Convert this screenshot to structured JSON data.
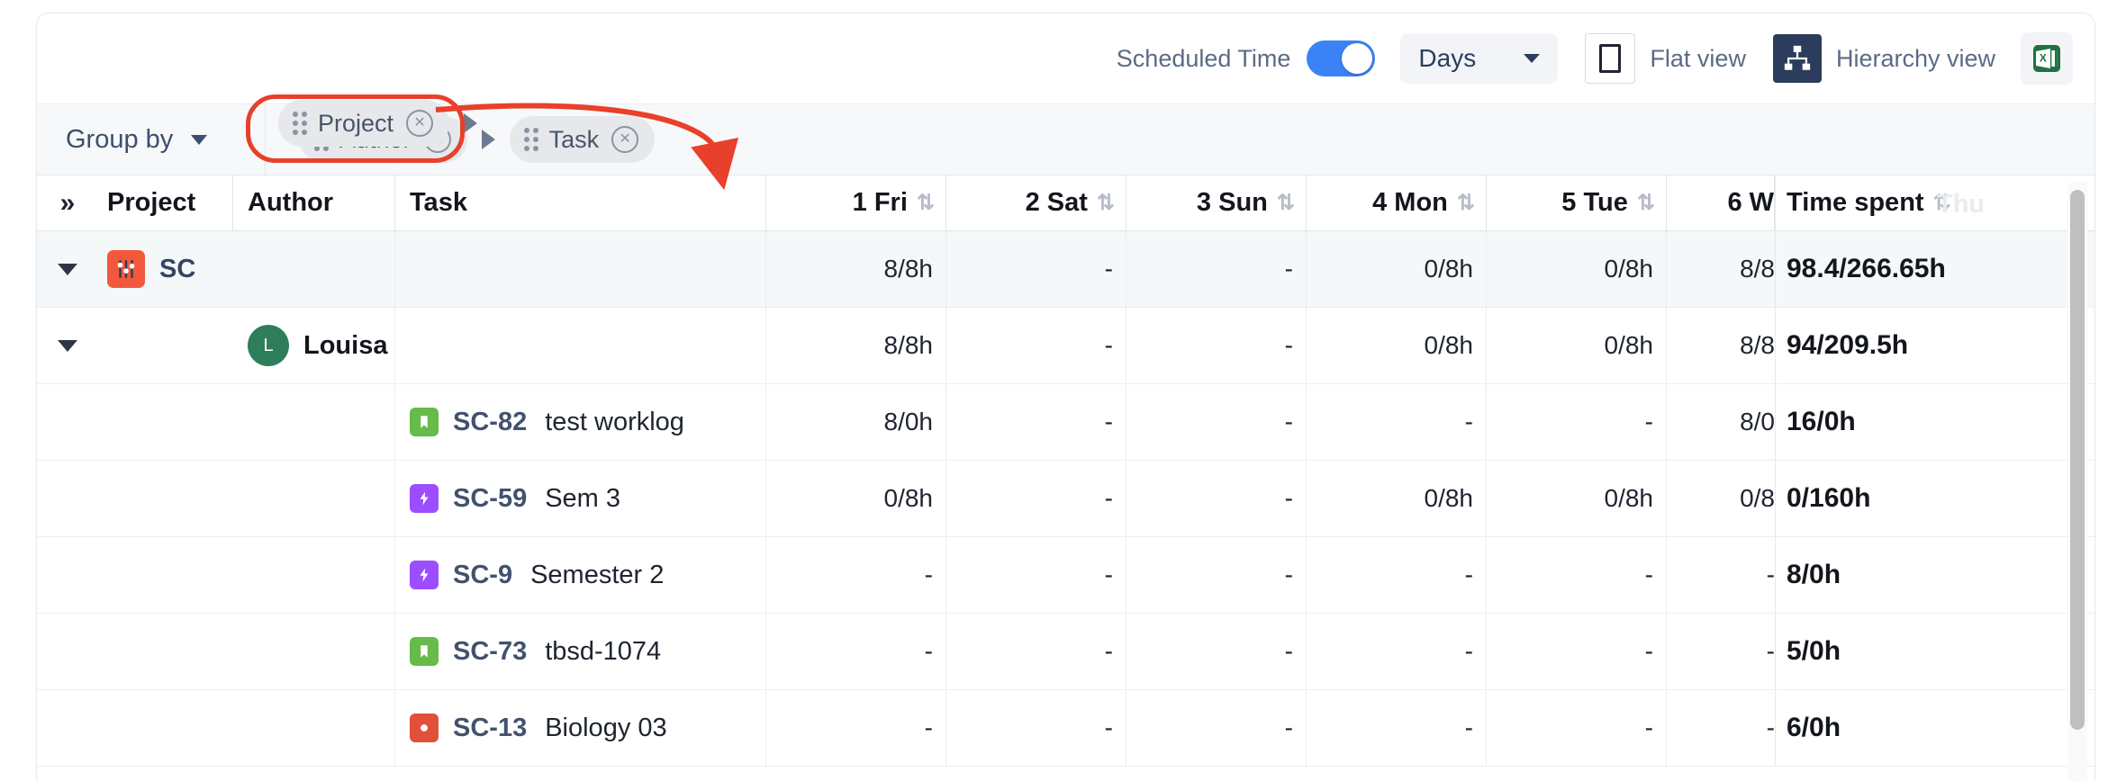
{
  "toolbar": {
    "scheduled_time_label": "Scheduled Time",
    "scheduled_time_on": true,
    "period_select_value": "Days",
    "flat_view_label": "Flat view",
    "hierarchy_view_label": "Hierarchy view",
    "export_icon": "excel-export-icon",
    "flat_view_icon": "square-outline-icon",
    "hierarchy_view_icon": "hierarchy-tree-icon",
    "chevron_icon": "chevron-down-icon"
  },
  "groupby": {
    "label": "Group by",
    "chevron_icon": "chevron-down-icon",
    "chips": [
      {
        "label": "Project",
        "grip_icon": "drag-grip-icon",
        "remove_icon": "remove-circle-icon",
        "highlighted": true
      },
      {
        "label": "Author",
        "grip_icon": "drag-grip-icon",
        "remove_icon": "remove-circle-icon",
        "highlighted": false
      },
      {
        "label": "Task",
        "grip_icon": "drag-grip-icon",
        "remove_icon": "remove-circle-icon",
        "highlighted": false
      }
    ],
    "separator_icon": "arrow-right-icon"
  },
  "annotation": {
    "highlight_color": "#e8402a",
    "arrow_icon": "curved-arrow-icon"
  },
  "table": {
    "expand_all_icon": "double-chevron-right-icon",
    "sort_icon": "sort-updown-icon",
    "ghost_header_text": "Thu",
    "columns": [
      {
        "key": "project",
        "label": "Project",
        "sortable": false
      },
      {
        "key": "author",
        "label": "Author",
        "sortable": false
      },
      {
        "key": "task",
        "label": "Task",
        "sortable": false
      },
      {
        "key": "d1",
        "label": "1 Fri",
        "sortable": true
      },
      {
        "key": "d2",
        "label": "2 Sat",
        "sortable": true
      },
      {
        "key": "d3",
        "label": "3 Sun",
        "sortable": true
      },
      {
        "key": "d4",
        "label": "4 Mon",
        "sortable": true
      },
      {
        "key": "d5",
        "label": "5 Tue",
        "sortable": true
      },
      {
        "key": "d6",
        "label": "6 W",
        "sortable": true
      },
      {
        "key": "spent",
        "label": "Time spent",
        "sortable": true
      }
    ],
    "rows": [
      {
        "type": "project",
        "expanded": true,
        "caret_icon": "chevron-down-icon",
        "icon": "project-sliders-icon",
        "icon_color": "#f2593c",
        "name": "SC",
        "days": [
          "8/8h",
          "-",
          "-",
          "0/8h",
          "0/8h",
          "8/8"
        ],
        "spent": "98.4/266.65h"
      },
      {
        "type": "author",
        "expanded": true,
        "caret_icon": "chevron-down-icon",
        "avatar_letter": "L",
        "avatar_color": "#2e7d5b",
        "name": "Louisa",
        "days": [
          "8/8h",
          "-",
          "-",
          "0/8h",
          "0/8h",
          "8/8"
        ],
        "spent": "94/209.5h"
      },
      {
        "type": "task",
        "icon": "story-bookmark-icon",
        "icon_color": "#66bb49",
        "key": "SC-82",
        "summary": "test worklog",
        "days": [
          "8/0h",
          "-",
          "-",
          "-",
          "-",
          "8/0"
        ],
        "spent": "16/0h"
      },
      {
        "type": "task",
        "icon": "epic-bolt-icon",
        "icon_color": "#9b4dff",
        "key": "SC-59",
        "summary": "Sem 3",
        "days": [
          "0/8h",
          "-",
          "-",
          "0/8h",
          "0/8h",
          "0/8"
        ],
        "spent": "0/160h"
      },
      {
        "type": "task",
        "icon": "epic-bolt-icon",
        "icon_color": "#9b4dff",
        "key": "SC-9",
        "summary": "Semester 2",
        "days": [
          "-",
          "-",
          "-",
          "-",
          "-",
          "-"
        ],
        "spent": "8/0h"
      },
      {
        "type": "task",
        "icon": "story-bookmark-icon",
        "icon_color": "#66bb49",
        "key": "SC-73",
        "summary": "tbsd-1074",
        "days": [
          "-",
          "-",
          "-",
          "-",
          "-",
          "-"
        ],
        "spent": "5/0h"
      },
      {
        "type": "task",
        "icon": "bug-circle-icon",
        "icon_color": "#e0503a",
        "key": "SC-13",
        "summary": "Biology 03",
        "days": [
          "-",
          "-",
          "-",
          "-",
          "-",
          "-"
        ],
        "spent": "6/0h"
      }
    ]
  },
  "scrollbar": {
    "orientation": "vertical"
  }
}
